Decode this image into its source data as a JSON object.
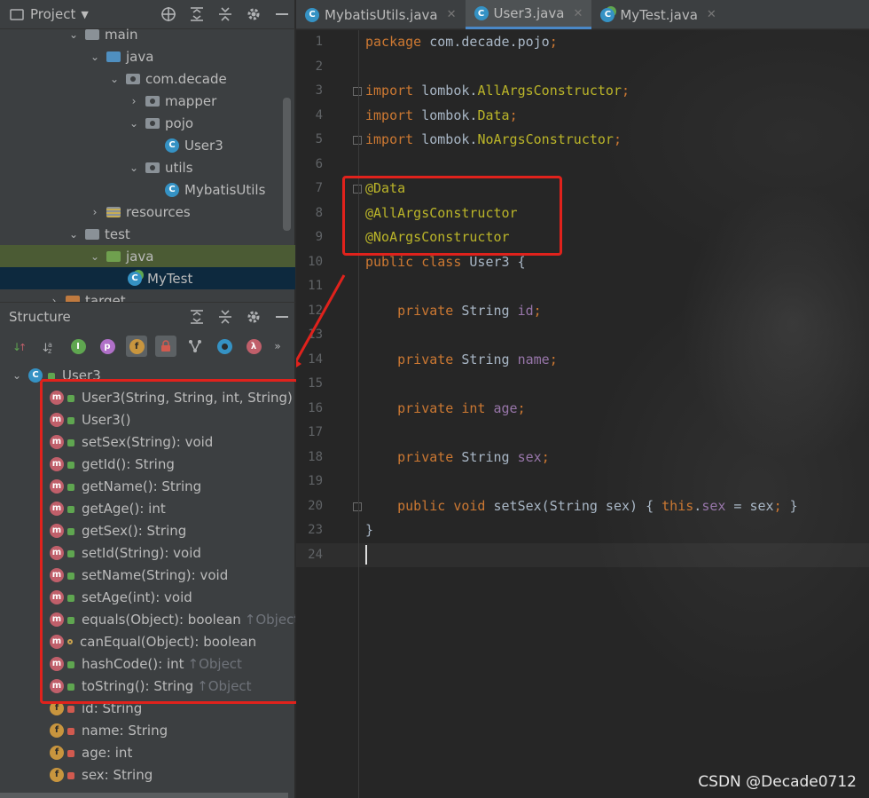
{
  "project_panel": {
    "title": "Project",
    "tree": [
      {
        "label": "main",
        "icon": "folder-icon",
        "arrow": "⌄"
      },
      {
        "label": "java",
        "icon": "source-folder-icon",
        "arrow": "⌄"
      },
      {
        "label": "com.decade",
        "icon": "package-icon",
        "arrow": "⌄"
      },
      {
        "label": "mapper",
        "icon": "package-icon",
        "arrow": "›"
      },
      {
        "label": "pojo",
        "icon": "package-icon",
        "arrow": "⌄"
      },
      {
        "label": "User3",
        "icon": "class-icon",
        "arrow": ""
      },
      {
        "label": "utils",
        "icon": "package-icon",
        "arrow": "⌄"
      },
      {
        "label": "MybatisUtils",
        "icon": "class-icon",
        "arrow": ""
      },
      {
        "label": "resources",
        "icon": "resources-folder-icon",
        "arrow": "›"
      },
      {
        "label": "test",
        "icon": "folder-icon",
        "arrow": "⌄"
      },
      {
        "label": "java",
        "icon": "test-source-folder-icon",
        "arrow": "⌄"
      },
      {
        "label": "MyTest",
        "icon": "test-class-icon",
        "arrow": ""
      },
      {
        "label": "target",
        "icon": "excluded-folder-icon",
        "arrow": "›"
      }
    ]
  },
  "structure_panel": {
    "title": "Structure",
    "root": "User3",
    "methods": [
      {
        "name": "User3(String, String, int, String)",
        "inherited": ""
      },
      {
        "name": "User3()",
        "inherited": ""
      },
      {
        "name": "setSex(String): void",
        "inherited": ""
      },
      {
        "name": "getId(): String",
        "inherited": ""
      },
      {
        "name": "getName(): String",
        "inherited": ""
      },
      {
        "name": "getAge(): int",
        "inherited": ""
      },
      {
        "name": "getSex(): String",
        "inherited": ""
      },
      {
        "name": "setId(String): void",
        "inherited": ""
      },
      {
        "name": "setName(String): void",
        "inherited": ""
      },
      {
        "name": "setAge(int): void",
        "inherited": ""
      },
      {
        "name": "equals(Object): boolean",
        "inherited": "↑Object"
      },
      {
        "name": "canEqual(Object): boolean",
        "inherited": ""
      },
      {
        "name": "hashCode(): int",
        "inherited": "↑Object"
      },
      {
        "name": "toString(): String",
        "inherited": "↑Object"
      }
    ],
    "fields": [
      {
        "name": "id: String"
      },
      {
        "name": "name: String"
      },
      {
        "name": "age: int"
      },
      {
        "name": "sex: String"
      }
    ]
  },
  "tabs": [
    {
      "label": "MybatisUtils.java"
    },
    {
      "label": "User3.java"
    },
    {
      "label": "MyTest.java"
    }
  ],
  "editor": {
    "line_numbers": [
      "1",
      "2",
      "3",
      "4",
      "5",
      "6",
      "7",
      "8",
      "9",
      "10",
      "11",
      "12",
      "13",
      "14",
      "15",
      "16",
      "17",
      "18",
      "19",
      "20",
      "23",
      "24"
    ],
    "lines": [
      "package com.decade.pojo;",
      "",
      "import lombok.AllArgsConstructor;",
      "import lombok.Data;",
      "import lombok.NoArgsConstructor;",
      "",
      "@Data",
      "@AllArgsConstructor",
      "@NoArgsConstructor",
      "public class User3 {",
      "",
      "    private String id;",
      "",
      "    private String name;",
      "",
      "    private int age;",
      "",
      "    private String sex;",
      "",
      "    public void setSex(String sex) { this.sex = sex; }",
      "}",
      ""
    ]
  },
  "watermark": "CSDN @Decade0712",
  "colors": {
    "keyword": "#cc7832",
    "annotation": "#bbb529",
    "field": "#9876aa",
    "highlight_box": "#e0221c"
  }
}
